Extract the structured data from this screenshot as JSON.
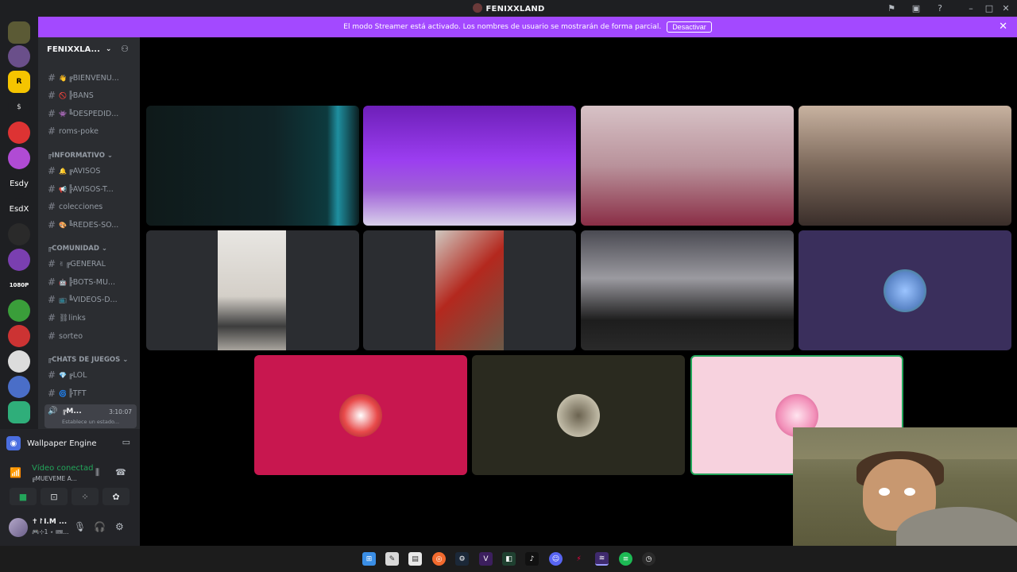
{
  "window": {
    "title": "FENIXXLAND",
    "controls": [
      "inbox-icon",
      "help-icon",
      "minimize-icon",
      "maximize-icon",
      "close-icon"
    ]
  },
  "banner": {
    "text": "El modo Streamer está activado. Los nombres de usuario se mostrarán de forma parcial.",
    "button": "Desactivar",
    "bg_color": "#a349ff"
  },
  "rail": {
    "text_items": [
      "Esdy",
      "EsdX",
      "1080P"
    ]
  },
  "server": {
    "name": "FENIXXLA..."
  },
  "channels": [
    {
      "emoji": "👋",
      "name": "╔BIENVENU..."
    },
    {
      "emoji": "🚫",
      "name": "╠BANS"
    },
    {
      "emoji": "👾",
      "name": "╚DESPEDID..."
    },
    {
      "emoji": "",
      "name": "roms-poke"
    }
  ],
  "categories": [
    "╔INFORMATIVO",
    "╔COMUNIDAD",
    "╔CHATS DE JUEGOS"
  ],
  "info_channels": [
    {
      "emoji": "🔔",
      "name": "╔AVISOS"
    },
    {
      "emoji": "📢",
      "name": "╠AVISOS-T..."
    },
    {
      "emoji": "",
      "name": "colecciones"
    },
    {
      "emoji": "🎨",
      "name": "╚REDES-SO..."
    }
  ],
  "community_channels": [
    {
      "emoji": "✌",
      "name": "╔GENERAL"
    },
    {
      "emoji": "🤖",
      "name": "╠BOTS-MU..."
    },
    {
      "emoji": "📺",
      "name": "╚VIDEOS-D..."
    },
    {
      "emoji": "",
      "name": "⛓links"
    },
    {
      "emoji": "",
      "name": "sorteo"
    }
  ],
  "game_channels": [
    {
      "emoji": "💎",
      "name": "╔LOL"
    },
    {
      "emoji": "🌀",
      "name": "╠TFT"
    }
  ],
  "active_voice": {
    "name": "╔M...",
    "time": "3:10:07",
    "status": "Establece un estado..."
  },
  "panel": {
    "activity": "Wallpaper Engine",
    "voice_status": "Vídeo conectad",
    "voice_channel": "╔MUEVEME A...",
    "user_name": "✝↾I.M ...",
    "user_sub": "🎮⊹1 ⋆ 🎟..."
  },
  "colors": {
    "accent": "#5865f2",
    "connected_green": "#23a55a",
    "tile_magenta": "#c8174f",
    "tile_olive": "#2a2a1f",
    "tile_pink": "#f7d2de",
    "tile_purple": "#3a2f5c"
  },
  "taskbar": [
    "windows-icon",
    "notepad-icon",
    "files-icon",
    "origin-icon",
    "steam-icon",
    "vtube-icon",
    "app-icon",
    "tiktok-icon",
    "discord-icon",
    "shortcut-icon",
    "twitch-icon",
    "spotify-icon",
    "clock-icon"
  ]
}
